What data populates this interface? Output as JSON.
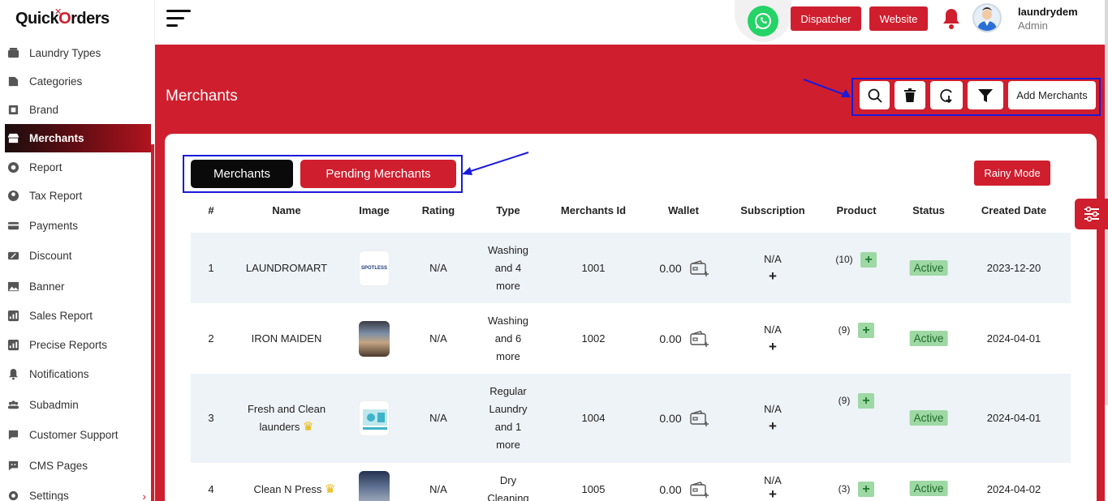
{
  "brand": {
    "name_part1": "Quick",
    "name_part2": "Orders",
    "name_o": "O",
    "name_rest": "rders"
  },
  "sidebar": {
    "items": [
      {
        "label": "Laundry Types",
        "icon": "laundry-icon"
      },
      {
        "label": "Categories",
        "icon": "categories-icon"
      },
      {
        "label": "Brand",
        "icon": "brand-icon"
      },
      {
        "label": "Merchants",
        "icon": "store-icon",
        "active": true
      },
      {
        "label": "Report",
        "icon": "report-icon"
      },
      {
        "label": "Tax Report",
        "icon": "tax-icon"
      },
      {
        "label": "Payments",
        "icon": "payments-icon"
      },
      {
        "label": "Discount",
        "icon": "discount-icon"
      },
      {
        "label": "Banner",
        "icon": "banner-icon"
      },
      {
        "label": "Sales Report",
        "icon": "sales-report-icon"
      },
      {
        "label": "Precise Reports",
        "icon": "precise-report-icon"
      },
      {
        "label": "Notifications",
        "icon": "bell-icon"
      },
      {
        "label": "Subadmin",
        "icon": "users-icon"
      },
      {
        "label": "Customer Support",
        "icon": "support-icon"
      },
      {
        "label": "CMS Pages",
        "icon": "cms-icon"
      },
      {
        "label": "Settings",
        "icon": "gear-icon"
      }
    ],
    "settings_chevron": "›"
  },
  "header": {
    "dispatcher_label": "Dispatcher",
    "website_label": "Website",
    "user_name": "laundrydem",
    "user_role": "Admin"
  },
  "page": {
    "title": "Merchants",
    "add_label": "Add Merchants",
    "tabs": [
      "Merchants",
      "Pending Merchants"
    ],
    "rainy_label": "Rainy Mode"
  },
  "table": {
    "headers": [
      "#",
      "Name",
      "Image",
      "Rating",
      "Type",
      "Merchants Id",
      "Wallet",
      "Subscription",
      "Product",
      "Status",
      "Created Date"
    ],
    "rows": [
      {
        "num": "1",
        "name": "LAUNDROMART",
        "rating": "N/A",
        "type": [
          "Washing",
          "and 4",
          "more"
        ],
        "id": "1001",
        "wallet": "0.00",
        "sub": "N/A",
        "sub_plus": "+",
        "product": "(10)",
        "status": "Active",
        "date": "2023-12-20"
      },
      {
        "num": "2",
        "name": "IRON MAIDEN",
        "rating": "N/A",
        "type": [
          "Washing",
          "and 6",
          "more"
        ],
        "id": "1002",
        "wallet": "0.00",
        "sub": "N/A",
        "sub_plus": "+",
        "product": "(9)",
        "status": "Active",
        "date": "2024-04-01"
      },
      {
        "num": "3",
        "name": [
          "Fresh and Clean",
          "launders"
        ],
        "rating": "N/A",
        "type": [
          "Regular",
          "Laundry",
          "and 1",
          "more"
        ],
        "id": "1004",
        "wallet": "0.00",
        "sub": "N/A",
        "sub_plus": "+",
        "product": "(9)",
        "status": "Active",
        "date": "2024-04-01"
      },
      {
        "num": "4",
        "name": "Clean N Press",
        "rating": "N/A",
        "type": [
          "Dry",
          "Cleaning"
        ],
        "id": "1005",
        "wallet": "0.00",
        "sub": "N/A",
        "sub_plus": "+",
        "product": "(3)",
        "status": "Active",
        "date": "2024-04-02"
      }
    ],
    "thumb1_text": "SPOTLESS"
  },
  "colors": {
    "accent": "#cf1e2e",
    "highlight_box": "#1a1adb",
    "active_bg": "#9ed8a4"
  }
}
